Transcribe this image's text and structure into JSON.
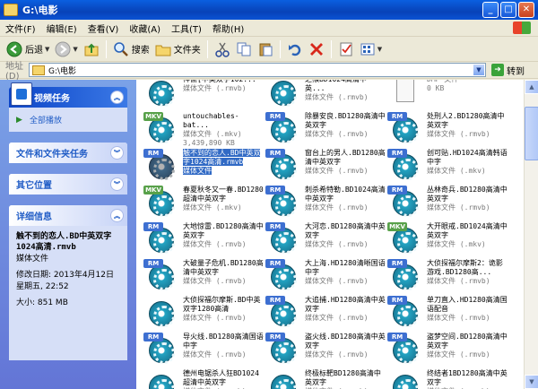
{
  "window": {
    "title": "G:\\电影"
  },
  "menu": [
    "文件(F)",
    "编辑(E)",
    "查看(V)",
    "收藏(A)",
    "工具(T)",
    "帮助(H)"
  ],
  "toolbar": {
    "back": "后退",
    "search": "搜索",
    "folders": "文件夹"
  },
  "address": {
    "label": "地址(D)",
    "path": "G:\\电影",
    "go": "转到"
  },
  "taskpane": {
    "video_tasks": {
      "title": "视频任务",
      "link": "全部播放"
    },
    "file_tasks": {
      "title": "文件和文件夹任务"
    },
    "other_places": {
      "title": "其它位置"
    },
    "details": {
      "title": "详细信息",
      "name": "触不到的恋人.BD中英双字1024高清.rmvb",
      "type": "媒体文件",
      "modified_label": "修改日期:",
      "modified_date": "2013年4月12日",
      "modified_time": "星期五, 22:52",
      "size": "大小: 851 MB"
    }
  },
  "files": [
    {
      "tag": "",
      "name": "神偷[中英双字102...",
      "type": "媒体文件 (.rmvb)",
      "size": ""
    },
    {
      "tag": "",
      "name": "之猴BD1024高清中英...",
      "type": "媒体文件 (.rmvb)",
      "size": ""
    },
    {
      "tag": "doc",
      "name": "",
      "type": "DMP 文件",
      "size": "0 KB"
    },
    {
      "tag": "MKV",
      "name": "untouchables-bat...",
      "type": "媒体文件 (.mkv)",
      "size": "3,439,890 KB"
    },
    {
      "tag": "RM",
      "name": "除暴安良.BD1280高清中英双字",
      "type": "媒体文件 (.rmvb)",
      "size": ""
    },
    {
      "tag": "RM",
      "name": "处刑人2.BD1280高清中英双字",
      "type": "媒体文件 (.rmvb)",
      "size": ""
    },
    {
      "tag": "RM",
      "name": "触不到的恋人.BD中英双字1024高清.rmvb",
      "type": "媒体文件",
      "size": "",
      "selected": true
    },
    {
      "tag": "RM",
      "name": "窗台上的男人.BD1280高清中英双字",
      "type": "媒体文件 (.rmvb)",
      "size": ""
    },
    {
      "tag": "RM",
      "name": "创可贴.HD1024高清韩语中字",
      "type": "媒体文件 (.mkv)",
      "size": ""
    },
    {
      "tag": "MKV",
      "name": "春夏秋冬又一春.BD1280超清中英双字",
      "type": "媒体文件 (.mkv)",
      "size": ""
    },
    {
      "tag": "RM",
      "name": "刺杀希特勒.BD1024高清中英双字",
      "type": "媒体文件 (.rmvb)",
      "size": ""
    },
    {
      "tag": "RM",
      "name": "丛林奇兵.BD1280高清中英双字",
      "type": "媒体文件 (.rmvb)",
      "size": ""
    },
    {
      "tag": "RM",
      "name": "大地惊雷.BD1280高清中英双字",
      "type": "媒体文件 (.rmvb)",
      "size": ""
    },
    {
      "tag": "RM",
      "name": "大河恋.BD1280高清中英双字",
      "type": "媒体文件 (.rmvb)",
      "size": ""
    },
    {
      "tag": "MKV",
      "name": "大开眼戒.BD1024高清中英双字",
      "type": "媒体文件 (.mkv)",
      "size": ""
    },
    {
      "tag": "RM",
      "name": "大破量子危机.BD1280高清中英双字",
      "type": "媒体文件 (.rmvb)",
      "size": ""
    },
    {
      "tag": "RM",
      "name": "大上海.HD1280清晰国语中字",
      "type": "媒体文件 (.rmvb)",
      "size": ""
    },
    {
      "tag": "RM",
      "name": "大侦探福尔摩斯2：诡影游戏.BD1280高...",
      "type": "媒体文件 (.rmvb)",
      "size": ""
    },
    {
      "tag": "",
      "name": "大侦探福尔摩斯.BD中英双字1280高清",
      "type": "媒体文件 (.rmvb)",
      "size": ""
    },
    {
      "tag": "RM",
      "name": "大追捕.HD1280高清中英双字",
      "type": "媒体文件 (.rmvb)",
      "size": ""
    },
    {
      "tag": "RM",
      "name": "单刀直入.HD1280高清国语配音",
      "type": "媒体文件 (.rmvb)",
      "size": ""
    },
    {
      "tag": "RM",
      "name": "导火线.BD1280高清国语中字",
      "type": "媒体文件 (.rmvb)",
      "size": ""
    },
    {
      "tag": "RM",
      "name": "盗火线.BD1280高清中英双字",
      "type": "媒体文件 (.rmvb)",
      "size": ""
    },
    {
      "tag": "RM",
      "name": "盗梦空间.BD1280高清中英双字",
      "type": "媒体文件 (.rmvb)",
      "size": ""
    },
    {
      "tag": "",
      "name": "德州电锯杀人狂BD1024超清中英双字",
      "type": "媒体文件 (.rmvb)",
      "size": ""
    },
    {
      "tag": "",
      "name": "终极标靶BD1280高清中英双字",
      "type": "媒体文件 (.rmvb)",
      "size": ""
    },
    {
      "tag": "",
      "name": "终结者1BD1280高清中英双字",
      "type": "媒体文件 (.rmvb)",
      "size": ""
    }
  ]
}
